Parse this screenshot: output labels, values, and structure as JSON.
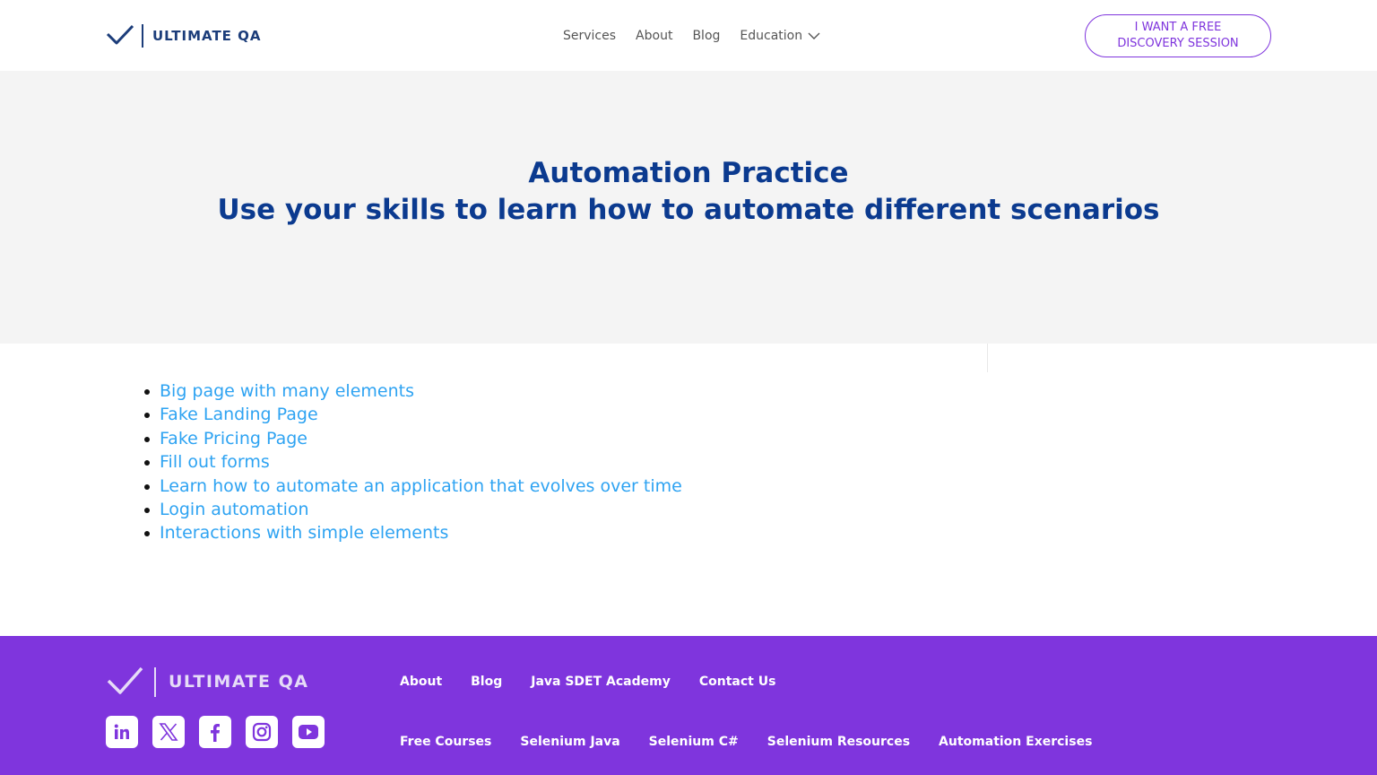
{
  "header": {
    "logo_text": "ULTIMATE QA",
    "nav": [
      "Services",
      "About",
      "Blog",
      "Education"
    ],
    "cta_label": "I WANT A FREE DISCOVERY SESSION"
  },
  "hero": {
    "title": "Automation Practice",
    "subtitle": "Use your skills to learn how to automate different scenarios"
  },
  "links": [
    "Big page with many elements",
    "Fake Landing Page",
    "Fake Pricing Page",
    "Fill out forms",
    "Learn how to automate an application that evolves over time",
    "Login automation",
    "Interactions with simple elements"
  ],
  "footer": {
    "logo_text": "ULTIMATE QA",
    "socials": [
      "linkedin-icon",
      "x-icon",
      "facebook-icon",
      "instagram-icon",
      "youtube-icon"
    ],
    "row1": [
      "About",
      "Blog",
      "Java SDET Academy",
      "Contact Us"
    ],
    "row2": [
      "Free Courses",
      "Selenium Java",
      "Selenium C#",
      "Selenium Resources",
      "Automation Exercises"
    ]
  },
  "colors": {
    "brand_blue": "#0b3a8f",
    "link_blue": "#2ea3f2",
    "purple": "#7f35dd",
    "hero_bg": "#f4f4f4"
  }
}
